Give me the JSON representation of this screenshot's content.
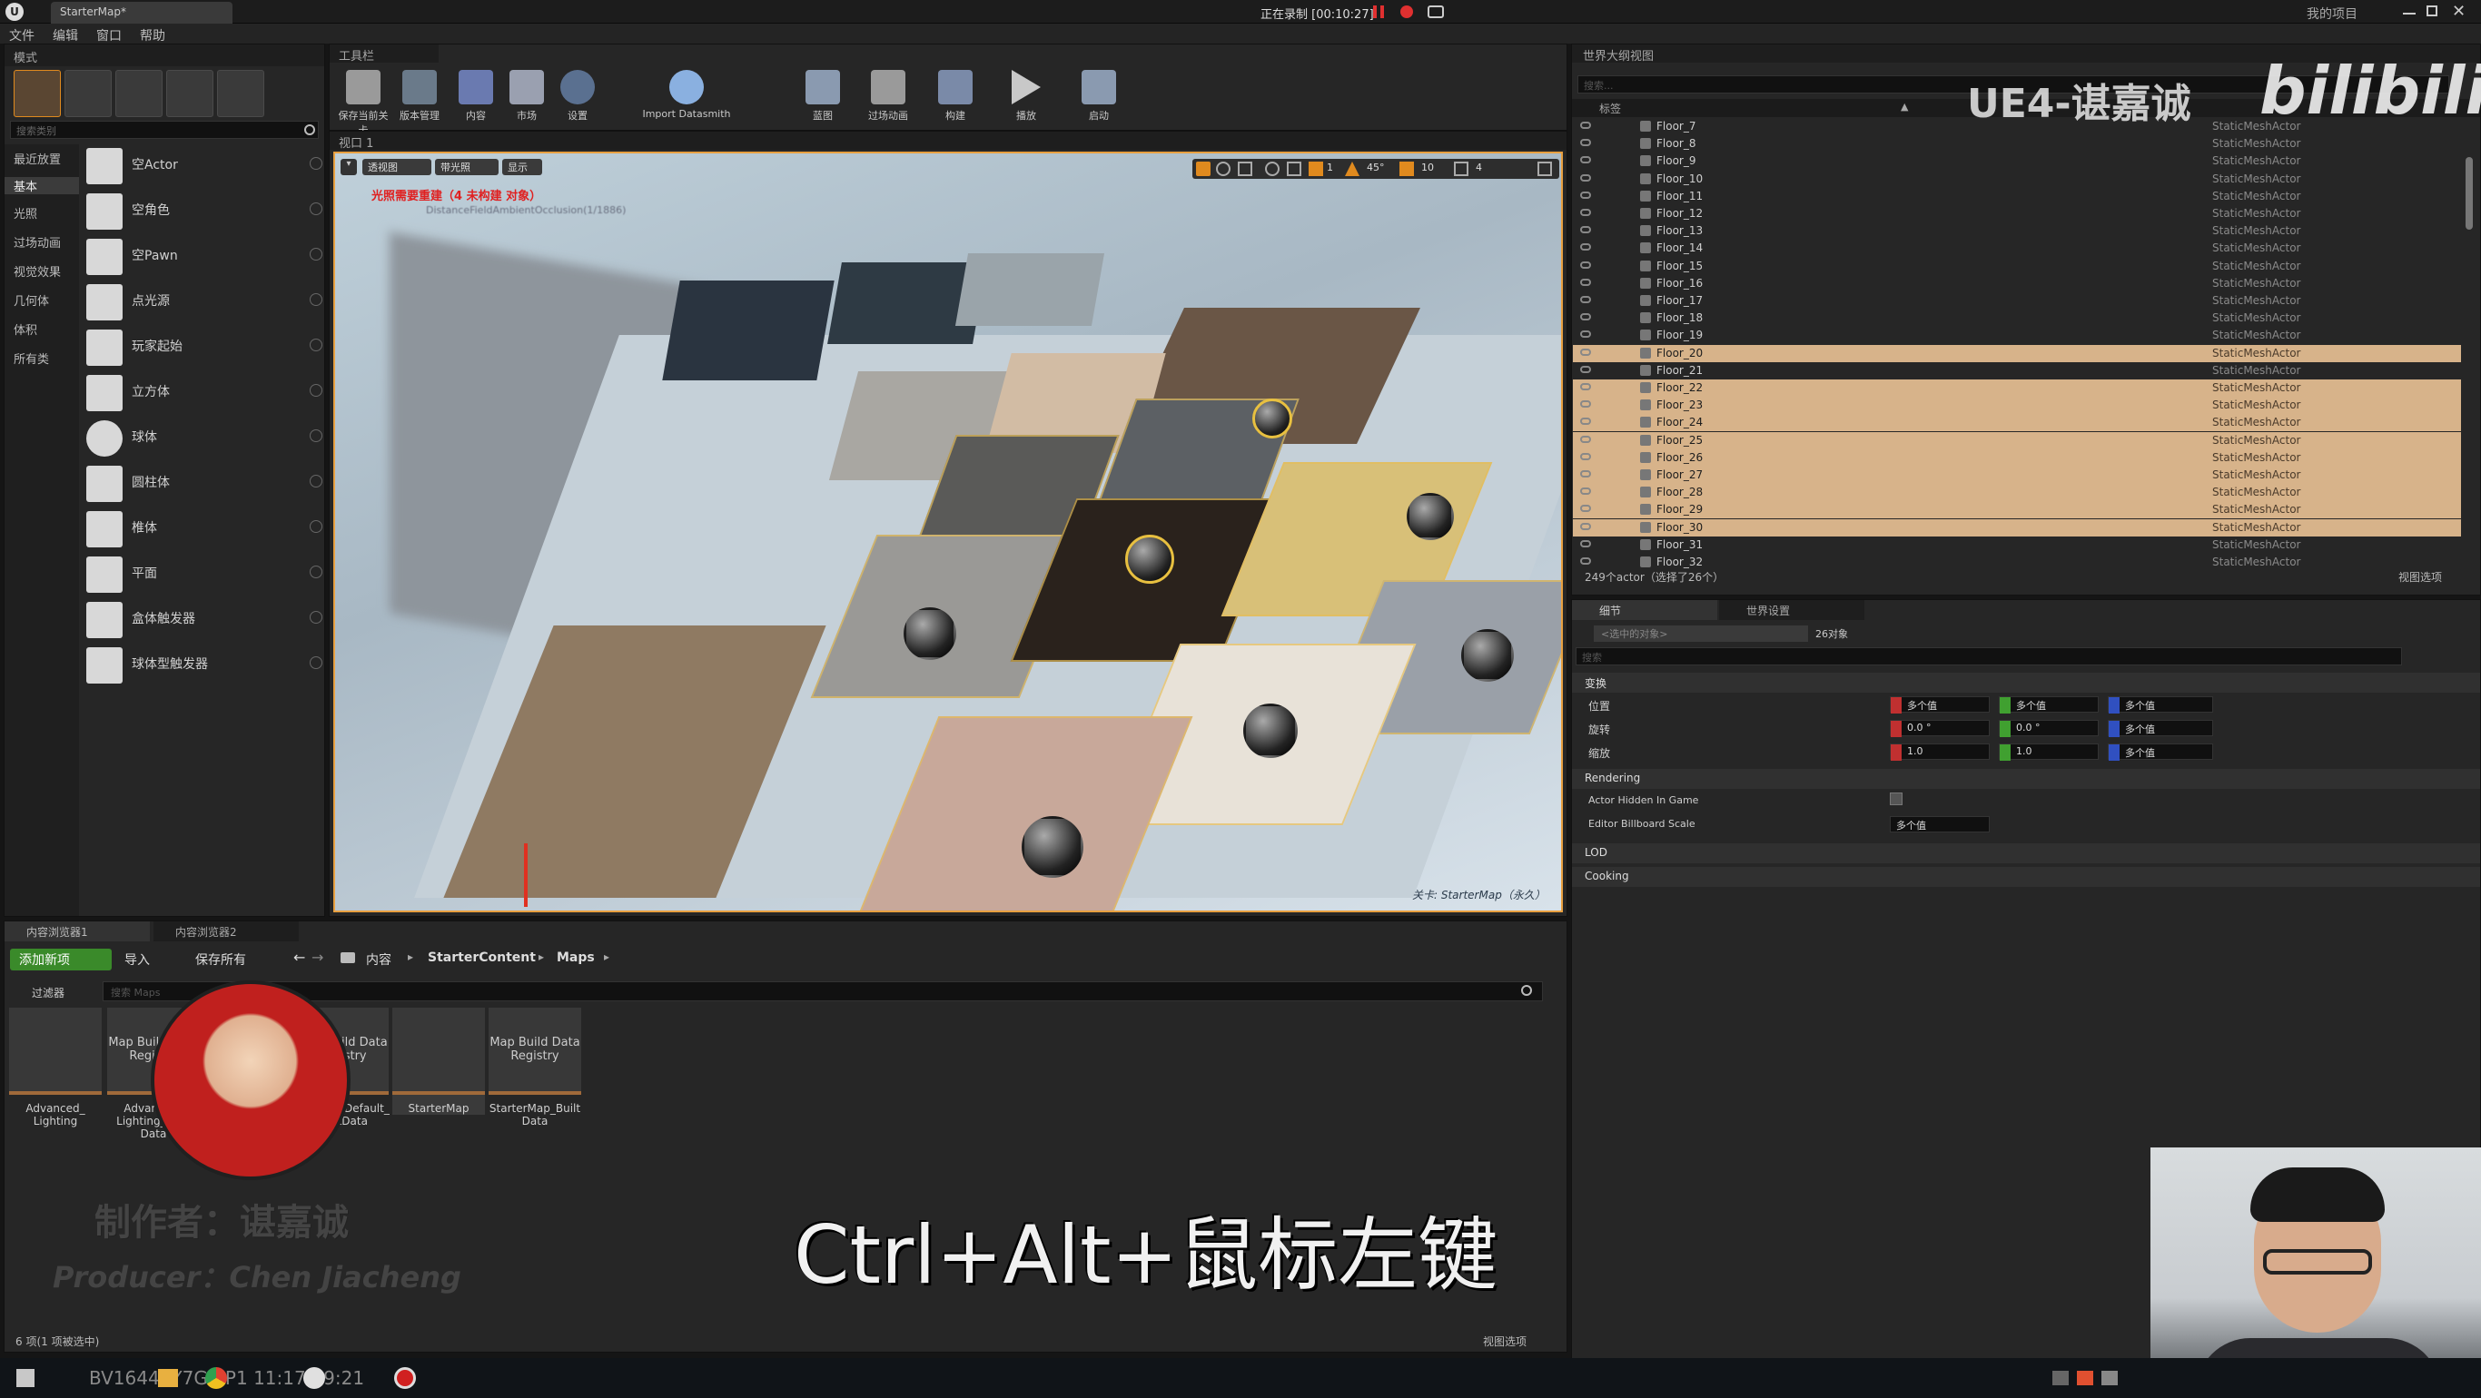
{
  "window": {
    "tab_title": "StarterMap*",
    "recording": "正在录制 [00:10:27]",
    "my_project": "我的项目"
  },
  "menu": [
    "文件",
    "编辑",
    "窗口",
    "帮助"
  ],
  "modes_panel": {
    "tab": "模式",
    "search_placeholder": "搜索类别",
    "categories": [
      "最近放置",
      "基本",
      "光照",
      "过场动画",
      "视觉效果",
      "几何体",
      "体积",
      "所有类"
    ],
    "items": [
      "空Actor",
      "空角色",
      "空Pawn",
      "点光源",
      "玩家起始",
      "立方体",
      "球体",
      "圆柱体",
      "椎体",
      "平面",
      "盒体触发器",
      "球体型触发器"
    ]
  },
  "toolbar": {
    "tab": "工具栏",
    "buttons": [
      "保存当前关卡",
      "版本管理",
      "内容",
      "市场",
      "设置",
      "Import Datasmith",
      "蓝图",
      "过场动画",
      "构建",
      "播放",
      "启动"
    ]
  },
  "viewport": {
    "tab": "视口 1",
    "view_buttons": [
      "透视图",
      "带光照",
      "显示"
    ],
    "warning": "光照需要重建（4 未构建 对象）",
    "subwarning": "DistanceFieldAmbientOcclusion(1/1886)",
    "grid": {
      "snap_toggle": "1",
      "angle": "45°",
      "scale": "10",
      "cam_speed": "4"
    },
    "level_label": "关卡: StarterMap（永久）"
  },
  "outliner": {
    "tab": "世界大纲视图",
    "search_placeholder": "搜索...",
    "column_label": "标签",
    "rows": [
      {
        "name": "Floor_7",
        "type": "StaticMeshActor",
        "sel": false
      },
      {
        "name": "Floor_8",
        "type": "StaticMeshActor",
        "sel": false
      },
      {
        "name": "Floor_9",
        "type": "StaticMeshActor",
        "sel": false
      },
      {
        "name": "Floor_10",
        "type": "StaticMeshActor",
        "sel": false
      },
      {
        "name": "Floor_11",
        "type": "StaticMeshActor",
        "sel": false
      },
      {
        "name": "Floor_12",
        "type": "StaticMeshActor",
        "sel": false
      },
      {
        "name": "Floor_13",
        "type": "StaticMeshActor",
        "sel": false
      },
      {
        "name": "Floor_14",
        "type": "StaticMeshActor",
        "sel": false
      },
      {
        "name": "Floor_15",
        "type": "StaticMeshActor",
        "sel": false
      },
      {
        "name": "Floor_16",
        "type": "StaticMeshActor",
        "sel": false
      },
      {
        "name": "Floor_17",
        "type": "StaticMeshActor",
        "sel": false
      },
      {
        "name": "Floor_18",
        "type": "StaticMeshActor",
        "sel": false
      },
      {
        "name": "Floor_19",
        "type": "StaticMeshActor",
        "sel": false
      },
      {
        "name": "Floor_20",
        "type": "StaticMeshActor",
        "sel": true
      },
      {
        "name": "Floor_21",
        "type": "StaticMeshActor",
        "sel": false
      },
      {
        "name": "Floor_22",
        "type": "StaticMeshActor",
        "sel": true
      },
      {
        "name": "Floor_23",
        "type": "StaticMeshActor",
        "sel": true
      },
      {
        "name": "Floor_24",
        "type": "StaticMeshActor",
        "sel": true
      },
      {
        "name": "Floor_25",
        "type": "StaticMeshActor",
        "sel": true
      },
      {
        "name": "Floor_26",
        "type": "StaticMeshActor",
        "sel": true
      },
      {
        "name": "Floor_27",
        "type": "StaticMeshActor",
        "sel": true
      },
      {
        "name": "Floor_28",
        "type": "StaticMeshActor",
        "sel": true
      },
      {
        "name": "Floor_29",
        "type": "StaticMeshActor",
        "sel": true
      },
      {
        "name": "Floor_30",
        "type": "StaticMeshActor",
        "sel": true
      },
      {
        "name": "Floor_31",
        "type": "StaticMeshActor",
        "sel": false
      },
      {
        "name": "Floor_32",
        "type": "StaticMeshActor",
        "sel": false
      }
    ],
    "footer": "249个actor（选择了26个）",
    "view_options": "视图选项"
  },
  "details": {
    "tabs": [
      "细节",
      "世界设置"
    ],
    "selected_placeholder": "<选中的对象>",
    "object_count": "26对象",
    "search_placeholder": "搜索",
    "transform_header": "变换",
    "location_label": "位置",
    "rotation_label": "旋转",
    "scale_label": "缩放",
    "location": [
      "多个值",
      "多个值",
      "多个值"
    ],
    "rotation": [
      "0.0 °",
      "0.0 °",
      "多个值"
    ],
    "scale": [
      "1.0",
      "1.0",
      "多个值"
    ],
    "rendering_header": "Rendering",
    "actor_hidden": "Actor Hidden In Game",
    "billboard": "Editor Billboard Scale",
    "billboard_value": "多个值",
    "lod_header": "LOD",
    "cooking_header": "Cooking"
  },
  "content_browser": {
    "tabs": [
      "内容浏览器1",
      "内容浏览器2"
    ],
    "add_new": "添加新项",
    "import": "导入",
    "save_all": "保存所有",
    "path": [
      "内容",
      "StarterContent",
      "Maps"
    ],
    "filters": "过滤器",
    "search_placeholder": "搜索 Maps",
    "assets": [
      {
        "thumb": "",
        "label": "Advanced_ Lighting"
      },
      {
        "thumb": "Map Build Data Registry",
        "label": "Advanced_ Lighting_Built Data"
      },
      {
        "thumb": "Map Build Data Registry",
        "label": "Minimal_Default_ BuiltData"
      },
      {
        "thumb": "",
        "label": "StarterMap"
      },
      {
        "thumb": "Map Build Data Registry",
        "label": "StarterMap_Built Data"
      }
    ],
    "status": "6 项(1 项被选中)",
    "view_options": "视图选项"
  },
  "overlays": {
    "shortcut": "Ctrl+Alt+鼠标左键",
    "maker": "制作者：谌嘉诚",
    "producer": "Producer：Chen Jiacheng",
    "brand": "UE4-谌嘉诚",
    "bili": "bilibili",
    "video_id": "BV16441Y7G2 P1 11:17:19:21"
  },
  "colors": {
    "selected_row": "#d7b38a",
    "accent_orange": "#e08a1e",
    "green_button": "#3a8a2a",
    "avatar_red": "#c0201e"
  }
}
